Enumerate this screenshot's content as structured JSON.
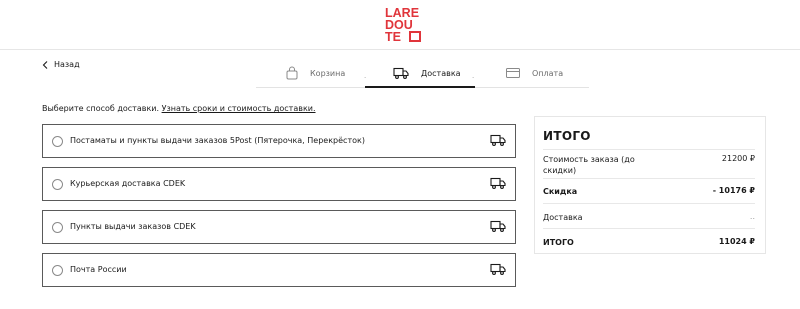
{
  "brand": {
    "logo_line1": "LARE",
    "logo_line2": "DOU",
    "logo_line3": "TE",
    "accent_color": "#e0353b"
  },
  "nav": {
    "back_label": "Назад"
  },
  "steps": [
    {
      "label": "Корзина",
      "icon": "bag-icon",
      "state": "done"
    },
    {
      "label": "Доставка",
      "icon": "truck-icon",
      "state": "active"
    },
    {
      "label": "Оплата",
      "icon": "card-icon",
      "state": "pending"
    }
  ],
  "steps_separator": ".",
  "delivery": {
    "prompt": "Выберите способ доставки.",
    "prompt_link": "Узнать сроки и стоимость доставки.",
    "options": [
      {
        "label": "Постаматы и пункты выдачи заказов 5Post (Пятерочка, Перекрёсток)",
        "icon": "truck-icon"
      },
      {
        "label": "Курьерская доставка CDEK",
        "icon": "truck-icon"
      },
      {
        "label": "Пункты выдачи заказов CDEK",
        "icon": "truck-icon"
      },
      {
        "label": "Почта России",
        "icon": "truck-icon"
      }
    ]
  },
  "summary": {
    "title": "ИТОГО",
    "order_cost_label": "Стоимость заказа (до скидки)",
    "order_cost_value": "21200 ₽",
    "discount_label": "Скидка",
    "discount_value": "- 10176 ₽",
    "shipping_label": "Доставка",
    "shipping_value": "..",
    "total_label": "ИТОГО",
    "total_value": "11024 ₽"
  }
}
